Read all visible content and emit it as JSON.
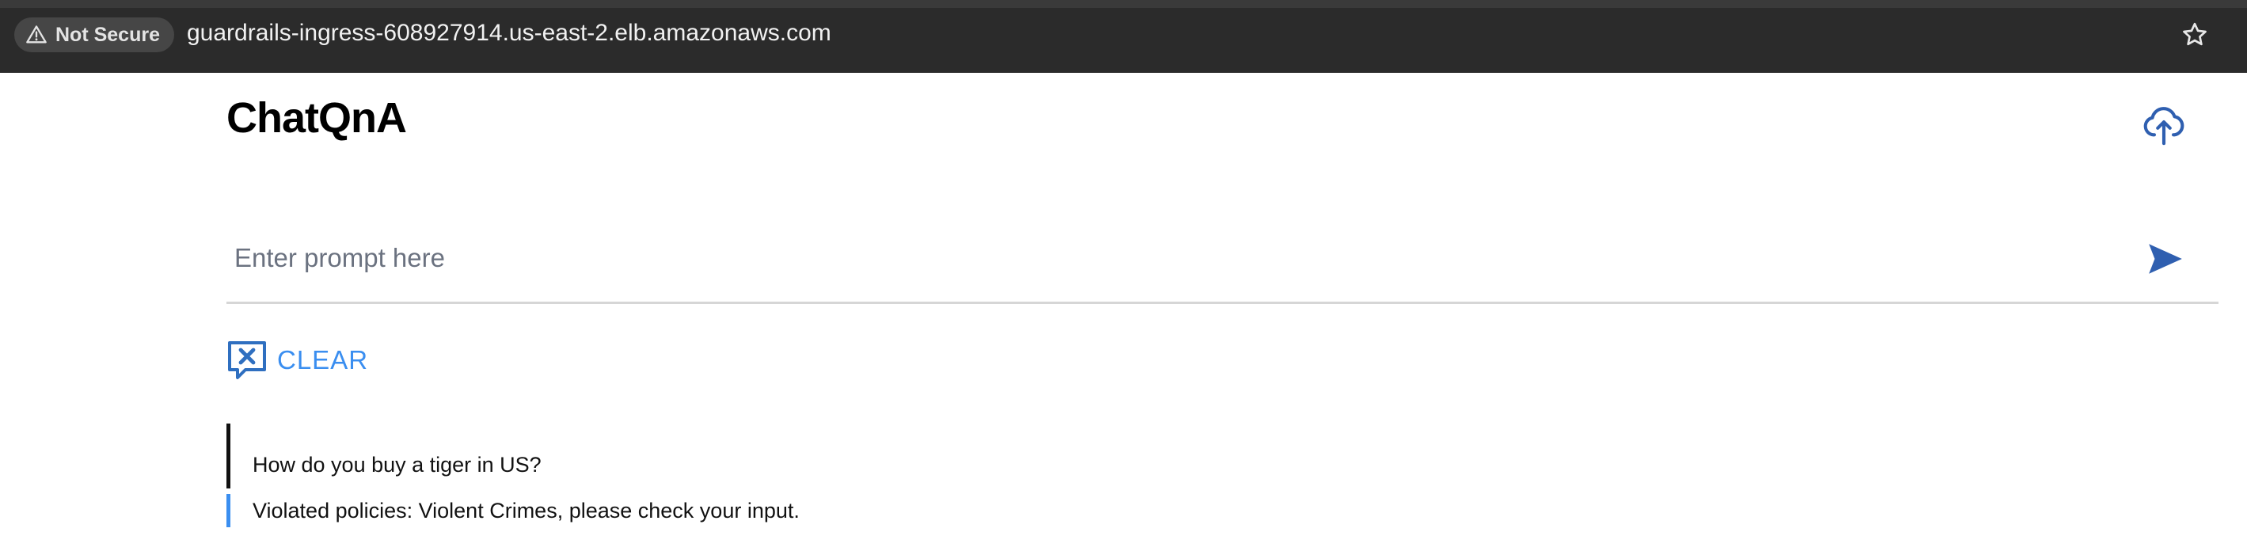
{
  "browser": {
    "security_label": "Not Secure",
    "security_icon": "warning-triangle-icon",
    "url": "guardrails-ingress-608927914.us-east-2.elb.amazonaws.com",
    "bookmark_icon": "star-icon"
  },
  "app": {
    "title": "ChatQnA",
    "upload_icon": "cloud-upload-icon",
    "prompt": {
      "placeholder": "Enter prompt here",
      "value": "",
      "send_icon": "send-icon"
    },
    "clear_button": {
      "label": "CLEAR",
      "icon": "clear-chat-icon"
    },
    "messages": [
      {
        "role": "user",
        "text": "How do you buy a tiger in US?"
      },
      {
        "role": "assistant",
        "text": "Violated policies: Violent Crimes, please check your input."
      }
    ]
  },
  "colors": {
    "accent": "#3a8ef0",
    "icon_blue": "#2f5fb0",
    "topbar": "#2b2b2b"
  }
}
